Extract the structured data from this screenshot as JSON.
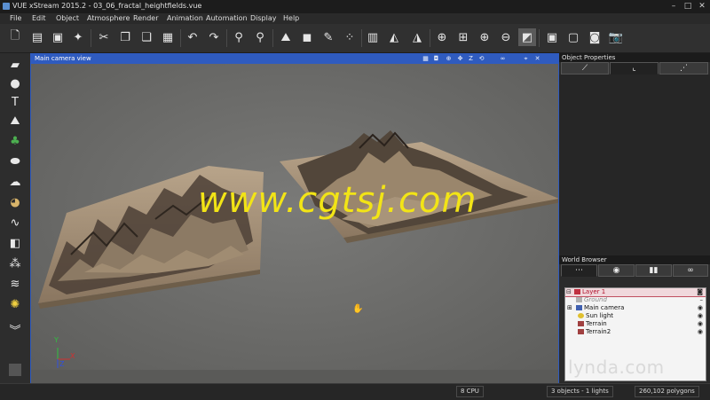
{
  "window": {
    "title": "VUE xStream 2015.2 - 03_06_fractal_heightfields.vue"
  },
  "menu": [
    "File",
    "Edit",
    "Object",
    "Atmosphere",
    "Render",
    "Animation",
    "Automation",
    "Display",
    "Help"
  ],
  "toolbar": {
    "icons": [
      "new-file-icon",
      "open-file-icon",
      "save-icon",
      "wand-icon",
      "cut-icon",
      "copy-icon",
      "paste-icon",
      "delete-icon",
      "undo-icon",
      "redo-icon",
      "link-icon",
      "unlink-icon",
      "terrain-icon",
      "cube-icon",
      "brush-icon",
      "material-icon",
      "film-icon",
      "flip-h-icon",
      "flip-v-icon",
      "globe-icon",
      "zoom-fit-icon",
      "zoom-in-icon",
      "zoom-out-icon",
      "render-region-icon",
      "display-options-icon",
      "frame-icon",
      "layout-icon",
      "camera-icon"
    ]
  },
  "toolbox": {
    "icons": [
      "plane-icon",
      "sphere-icon",
      "text-icon",
      "terrain-tool-icon",
      "tree-icon",
      "rock-icon",
      "cloud-icon",
      "planet-icon",
      "path-icon",
      "cube-tool-icon",
      "particles-icon",
      "tornado-icon",
      "light-icon",
      "expand-icon"
    ]
  },
  "viewport": {
    "title": "Main camera view",
    "icons": [
      "vp-grid-icon",
      "vp-camera-icon",
      "vp-zoom-icon",
      "vp-z-icon",
      "vp-pan-icon",
      "vp-rotate-icon",
      "vp-link-icon",
      "vp-pin-icon",
      "vp-close-icon"
    ],
    "axes": {
      "x": "X",
      "y": "Y",
      "z": "Z"
    }
  },
  "watermark": "www.cgtsj.com",
  "object_properties": {
    "title": "Object Properties",
    "tabs": [
      "",
      "",
      ""
    ]
  },
  "world_browser": {
    "title": "World Browser",
    "tabs": [
      "",
      "",
      "",
      ""
    ],
    "tree": [
      {
        "label": "Layer 1",
        "style": "layer"
      },
      {
        "label": "Ground",
        "style": "disabled"
      },
      {
        "label": "Main camera",
        "style": "normal"
      },
      {
        "label": "Sun light",
        "style": "normal"
      },
      {
        "label": "Terrain",
        "style": "normal"
      },
      {
        "label": "Terrain2",
        "style": "normal"
      }
    ]
  },
  "status": {
    "cpu": "8 CPU",
    "objects": "3 objects - 1 lights",
    "polygons": "260,102 polygons"
  },
  "brand": "lynda.com",
  "colors": {
    "viewport_border": "#2f5bbf",
    "watermark": "#f2e416",
    "layer_text": "#b0102a"
  }
}
